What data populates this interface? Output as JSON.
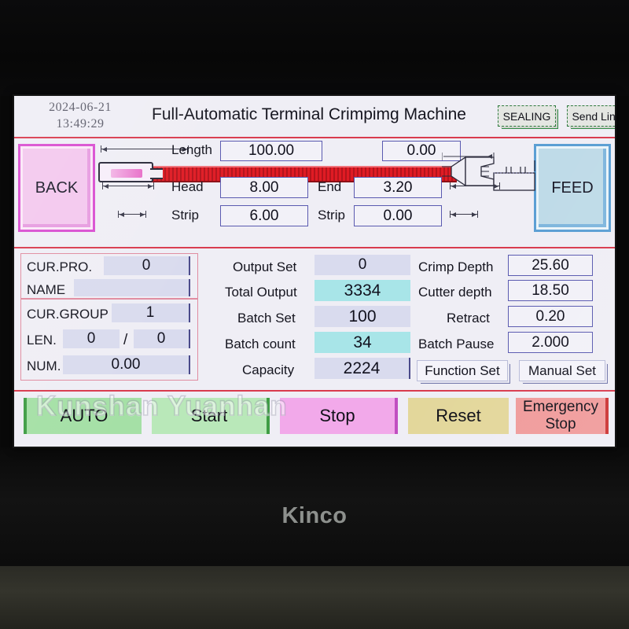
{
  "device": {
    "brand": "Kinco"
  },
  "header": {
    "date": "2024-06-21",
    "time": "13:49:29",
    "title": "Full-Automatic Terminal Crimpimg Machine",
    "sealing_label": "SEALING",
    "send_line_label": "Send Line"
  },
  "watermark": "Kunshan Yuanhan",
  "diagram": {
    "back_label": "BACK",
    "feed_label": "FEED",
    "length_label": "Length",
    "length_value": "100.00",
    "right_top_value": "0.00",
    "head_label": "Head",
    "head_value": "8.00",
    "end_label": "End",
    "end_value": "3.20",
    "strip_left_label": "Strip",
    "strip_left_value": "6.00",
    "strip_right_label": "Strip",
    "strip_right_value": "0.00"
  },
  "panel_left": {
    "cur_pro_label": "CUR.PRO.",
    "cur_pro_value": "0",
    "name_label": "NAME",
    "name_value": "",
    "cur_group_label": "CUR.GROUP",
    "cur_group_value": "1",
    "len_label": "LEN.",
    "len_value_a": "0",
    "len_separator": "/",
    "len_value_b": "0",
    "num_label": "NUM.",
    "num_value": "0.00"
  },
  "panel_mid": {
    "output_set_label": "Output Set",
    "output_set_value": "0",
    "total_output_label": "Total Output",
    "total_output_value": "3334",
    "batch_set_label": "Batch Set",
    "batch_set_value": "100",
    "batch_count_label": "Batch count",
    "batch_count_value": "34",
    "capacity_label": "Capacity",
    "capacity_value": "2224"
  },
  "panel_right": {
    "crimp_depth_label": "Crimp Depth",
    "crimp_depth_value": "25.60",
    "cutter_depth_label": "Cutter depth",
    "cutter_depth_value": "18.50",
    "retract_label": "Retract",
    "retract_value": "0.20",
    "batch_pause_label": "Batch Pause",
    "batch_pause_value": "2.000",
    "function_set_label": "Function Set",
    "manual_set_label": "Manual Set"
  },
  "controls": {
    "auto_label": "AUTO",
    "start_label": "Start",
    "stop_label": "Stop",
    "reset_label": "Reset",
    "emergency_stop_label": "Emergency\nStop"
  },
  "colors": {
    "separator": "#d93b4e",
    "lcd_bg": "#efeef5",
    "highlight_cyan": "#a8e5e8",
    "field_blue": "#d9dbee",
    "auto_green": "#a5e0a6",
    "stop_pink": "#f2a9ea",
    "reset_tan": "#e3d79b",
    "estop_red": "#f09b9b"
  }
}
